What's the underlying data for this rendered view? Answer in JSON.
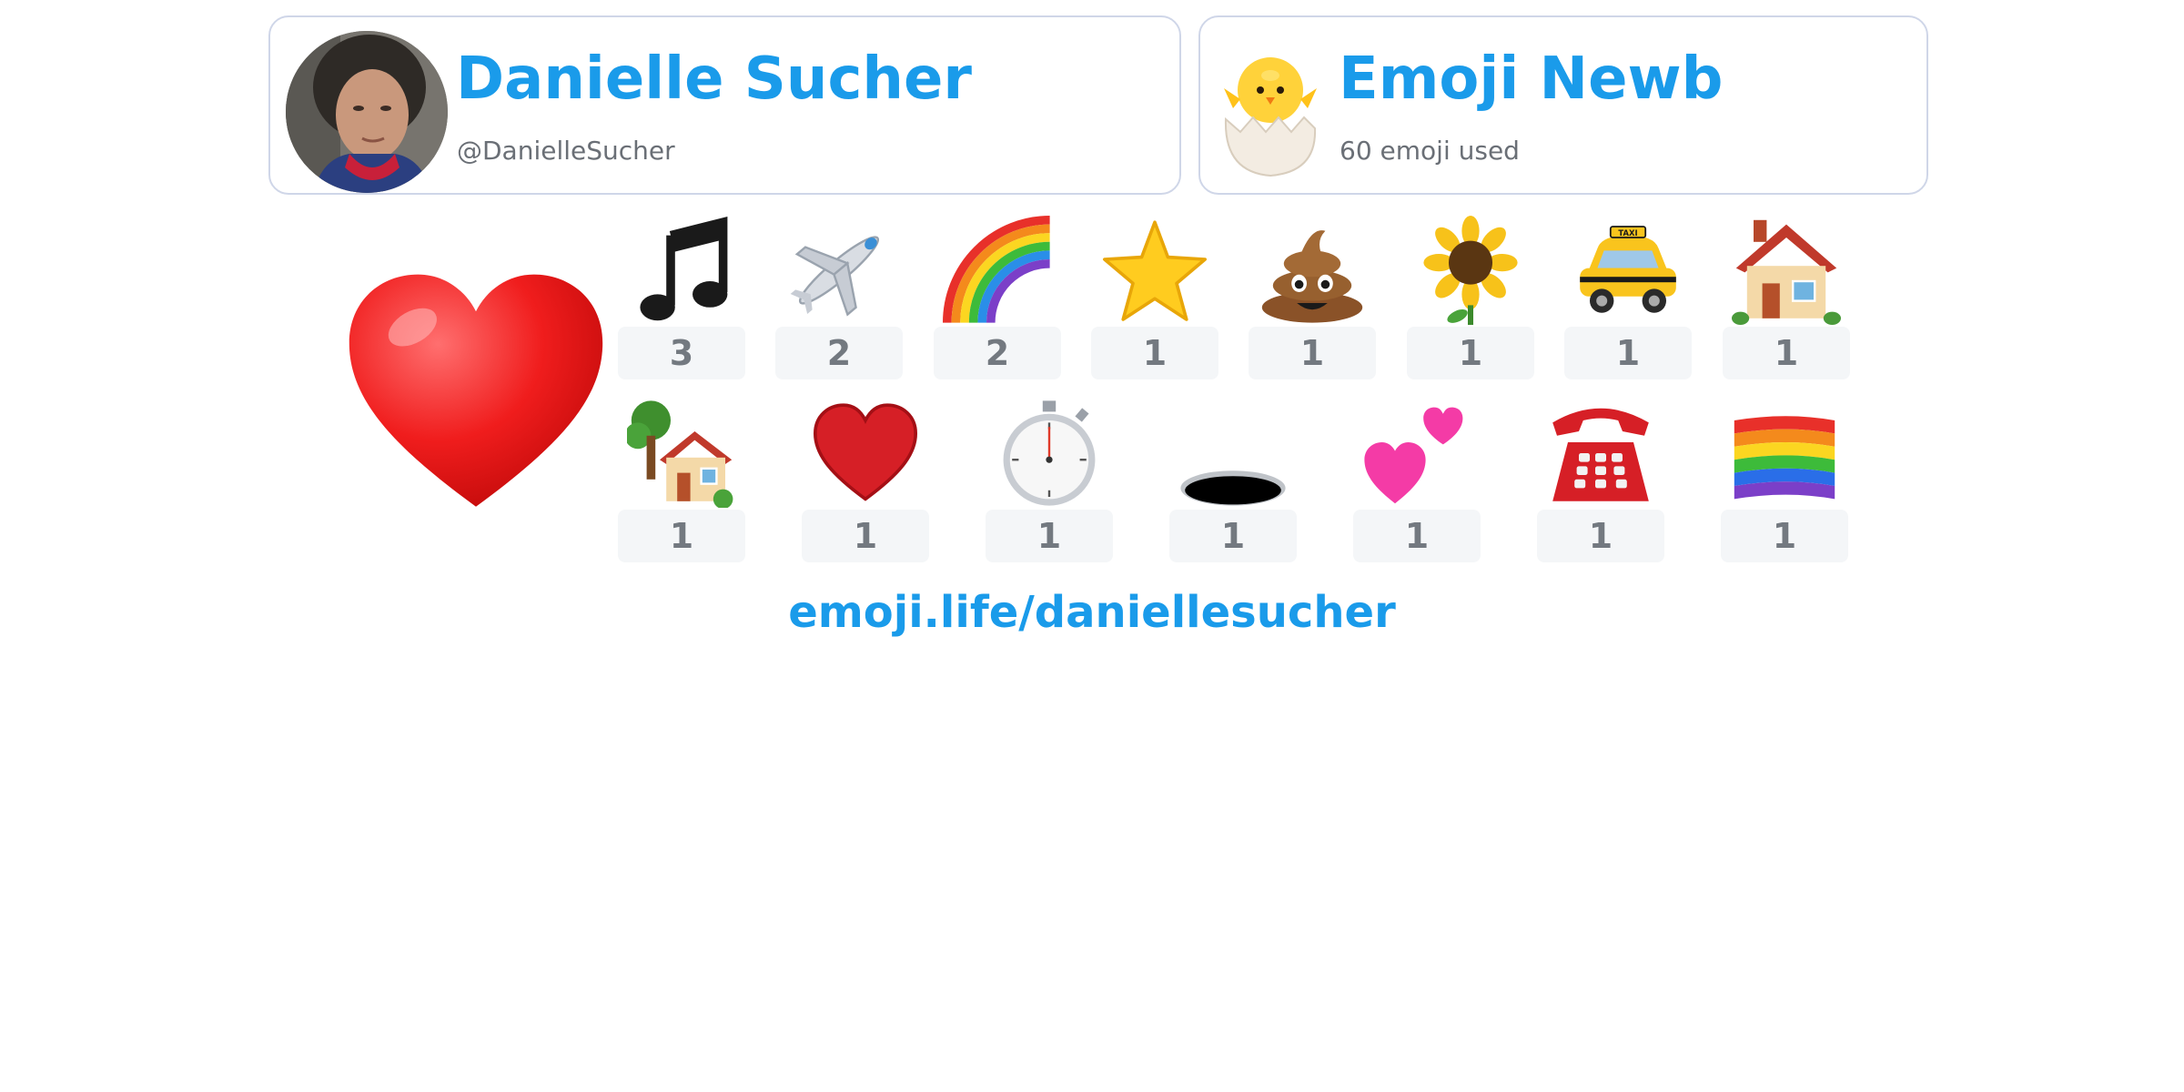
{
  "profile": {
    "name": "Danielle Sucher",
    "handle": "@DanielleSucher"
  },
  "badge": {
    "title": "Emoji Newb",
    "subtitle": "60 emoji used",
    "icon": "hatching-chick-icon"
  },
  "top_emoji": {
    "icon": "red-heart-icon"
  },
  "emoji_grid": {
    "row1": [
      {
        "icon": "musical-notes-icon",
        "count": "3"
      },
      {
        "icon": "airplane-icon",
        "count": "2"
      },
      {
        "icon": "rainbow-icon",
        "count": "2"
      },
      {
        "icon": "star-icon",
        "count": "1"
      },
      {
        "icon": "pile-of-poo-icon",
        "count": "1"
      },
      {
        "icon": "sunflower-icon",
        "count": "1"
      },
      {
        "icon": "taxi-icon",
        "count": "1"
      },
      {
        "icon": "house-icon",
        "count": "1"
      }
    ],
    "row2": [
      {
        "icon": "house-with-garden-icon",
        "count": "1"
      },
      {
        "icon": "red-heart-icon",
        "count": "1"
      },
      {
        "icon": "stopwatch-icon",
        "count": "1"
      },
      {
        "icon": "hole-icon",
        "count": "1"
      },
      {
        "icon": "two-hearts-icon",
        "count": "1"
      },
      {
        "icon": "telephone-icon",
        "count": "1"
      },
      {
        "icon": "rainbow-flag-icon",
        "count": "1"
      }
    ]
  },
  "footer": {
    "link": "emoji.life/daniellesucher"
  },
  "colors": {
    "accent": "#1a9bea",
    "muted_text": "#6a6f76",
    "card_border": "#cfd6e8",
    "count_bg": "#f4f6f8"
  }
}
